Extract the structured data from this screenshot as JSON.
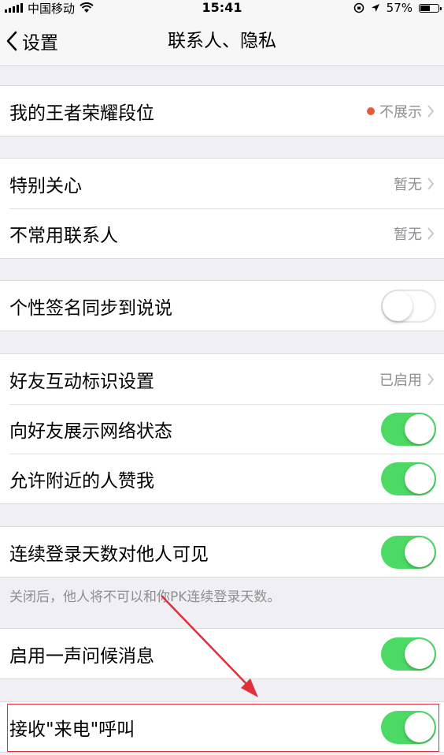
{
  "status_bar": {
    "carrier": "中国移动",
    "time": "15:41",
    "battery": "57%",
    "battery_level": 0.57
  },
  "nav": {
    "back_label": "设置",
    "title": "联系人、隐私"
  },
  "rows": {
    "rank": {
      "label": "我的王者荣耀段位",
      "value": "不展示"
    },
    "special_care": {
      "label": "特别关心",
      "value": "暂无"
    },
    "infrequent": {
      "label": "不常用联系人",
      "value": "暂无"
    },
    "signature_sync": {
      "label": "个性签名同步到说说",
      "on": false
    },
    "interaction_mark": {
      "label": "好友互动标识设置",
      "value": "已启用"
    },
    "network_status": {
      "label": "向好友展示网络状态",
      "on": true
    },
    "nearby_like": {
      "label": "允许附近的人赞我",
      "on": true
    },
    "login_days": {
      "label": "连续登录天数对他人可见",
      "on": true
    },
    "greeting": {
      "label": "启用一声问候消息",
      "on": true
    },
    "receive_call": {
      "label": "接收\"来电\"呼叫",
      "on": true
    }
  },
  "footnote": "关闭后，他人将不可以和你PK连续登录天数。",
  "colors": {
    "toggle_on": "#4cd964",
    "dot": "#e55b3c",
    "annotation": "#e0303a"
  }
}
